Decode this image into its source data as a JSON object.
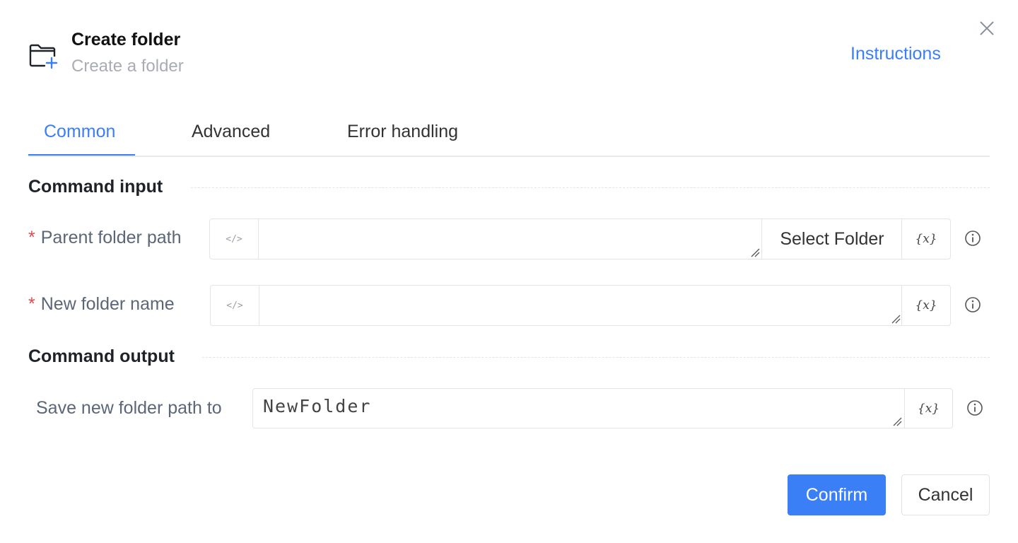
{
  "header": {
    "title": "Create folder",
    "subtitle": "Create a folder",
    "instructions_link": "Instructions",
    "icon": "folder-plus-icon",
    "close_icon": "close-icon"
  },
  "tabs": [
    {
      "label": "Common",
      "active": true
    },
    {
      "label": "Advanced",
      "active": false
    },
    {
      "label": "Error handling",
      "active": false
    }
  ],
  "sections": {
    "input_title": "Command input",
    "output_title": "Command output"
  },
  "fields": {
    "parent_folder": {
      "required_mark": "*",
      "label": "Parent folder path",
      "code_toggle": "</>",
      "value": "",
      "select_button": "Select Folder",
      "variable_button": "{x}"
    },
    "new_folder_name": {
      "required_mark": "*",
      "label": "New folder name",
      "code_toggle": "</>",
      "value": "",
      "variable_button": "{x}"
    },
    "save_path": {
      "label": "Save new folder path to",
      "value": "NewFolder",
      "variable_button": "{x}"
    }
  },
  "footer": {
    "confirm": "Confirm",
    "cancel": "Cancel"
  },
  "colors": {
    "accent": "#3a7ff6",
    "required": "#e5484d",
    "label": "#5b6678"
  }
}
